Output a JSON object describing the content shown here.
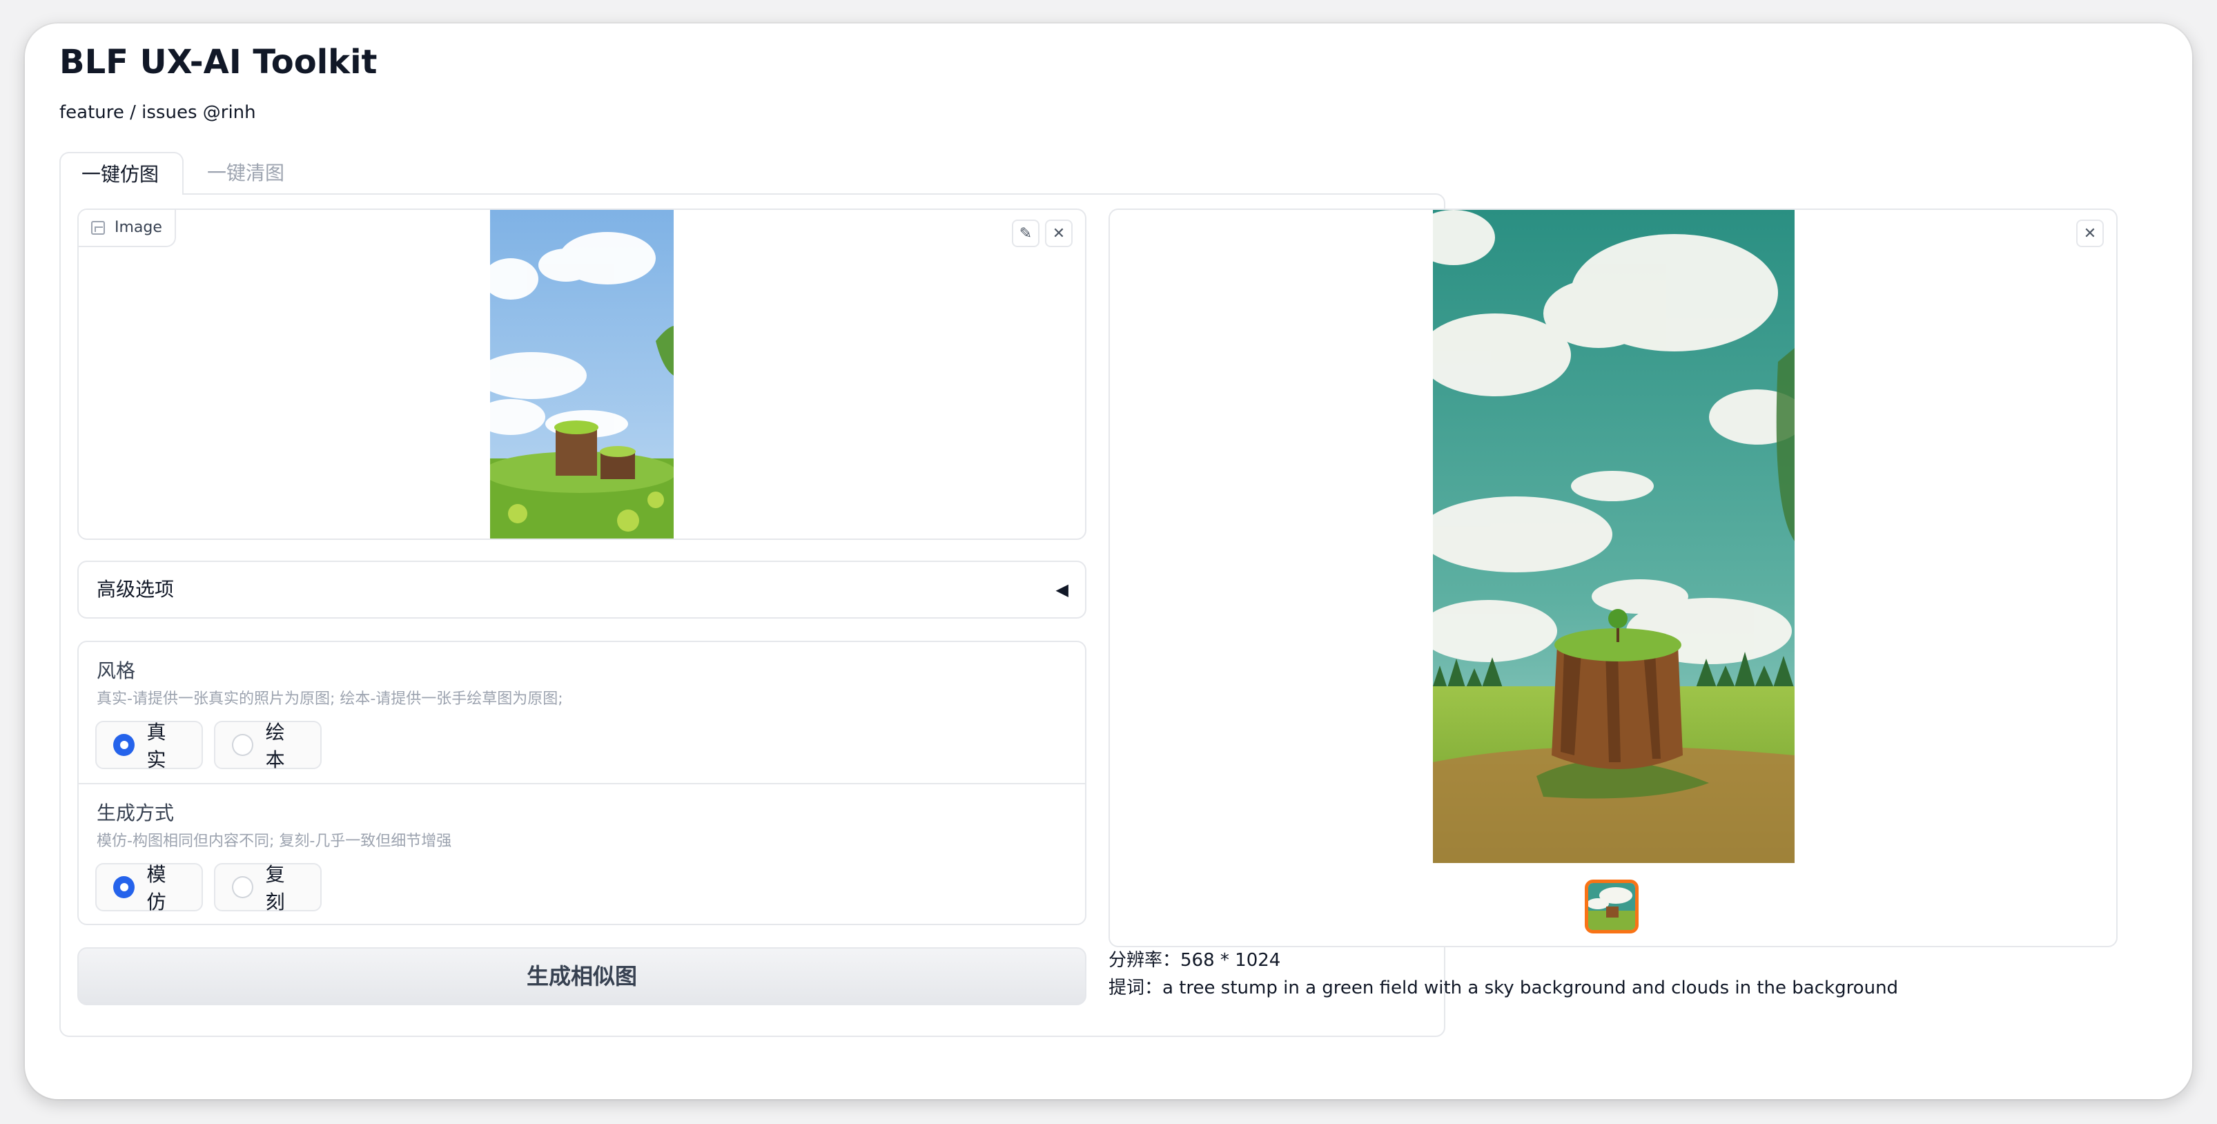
{
  "app": {
    "title": "BLF UX-AI Toolkit",
    "subtitle": "feature / issues @rinh"
  },
  "tabs": [
    {
      "label": "一键仿图",
      "active": true
    },
    {
      "label": "一键清图",
      "active": false
    }
  ],
  "input_image": {
    "label": "Image",
    "icon": "image-icon",
    "edit_icon": "pencil-icon",
    "close_icon": "close-icon"
  },
  "advanced": {
    "label": "高级选项",
    "arrow": "◀"
  },
  "style_group": {
    "title": "风格",
    "description": "真实-请提供一张真实的照片为原图; 绘本-请提供一张手绘草图为原图;",
    "options": [
      {
        "label": "真实",
        "selected": true
      },
      {
        "label": "绘本",
        "selected": false
      }
    ]
  },
  "mode_group": {
    "title": "生成方式",
    "description": "模仿-构图相同但内容不同; 复刻-几乎一致但细节增强",
    "options": [
      {
        "label": "模仿",
        "selected": true
      },
      {
        "label": "复刻",
        "selected": false
      }
    ]
  },
  "generate_button": "生成相似图",
  "output": {
    "close_icon": "close-icon",
    "resolution_label": "分辨率：",
    "resolution_value": "568 * 1024",
    "prompt_label": "提词：",
    "prompt_value": "a tree stump in a green field with a sky background and clouds in the background"
  },
  "colors": {
    "accent": "#2563eb",
    "thumb_border": "#f97316",
    "border": "#e5e7eb"
  }
}
